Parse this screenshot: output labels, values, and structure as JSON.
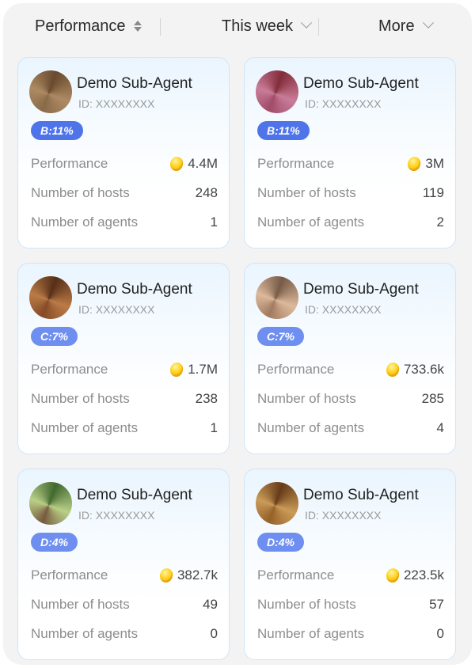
{
  "filters": {
    "performance": "Performance",
    "week": "This week",
    "more": "More"
  },
  "cards": [
    {
      "name": "Demo Sub-Agent",
      "id_label": "ID:",
      "id_value": "XXXXXXXX",
      "badge": "B:11%",
      "performance": "4.4M",
      "hosts": "248",
      "agents": "1",
      "avatar_colors": [
        "#6b4a2a",
        "#b08a5e",
        "#8c6a44"
      ]
    },
    {
      "name": "Demo Sub-Agent",
      "id_label": "ID:",
      "id_value": "XXXXXXXX",
      "badge": "B:11%",
      "performance": "3M",
      "hosts": "119",
      "agents": "2",
      "avatar_colors": [
        "#8a2a3a",
        "#d07a9a",
        "#a84a6a"
      ]
    },
    {
      "name": "Demo Sub-Agent",
      "id_label": "ID:",
      "id_value": "XXXXXXXX",
      "badge": "C:7%",
      "performance": "1.7M",
      "hosts": "238",
      "agents": "1",
      "avatar_colors": [
        "#5a2e14",
        "#c07a40",
        "#8a4a22"
      ]
    },
    {
      "name": "Demo Sub-Agent",
      "id_label": "ID:",
      "id_value": "XXXXXXXX",
      "badge": "C:7%",
      "performance": "733.6k",
      "hosts": "285",
      "agents": "4",
      "avatar_colors": [
        "#7a5a44",
        "#e0b898",
        "#a47a5c"
      ]
    },
    {
      "name": "Demo Sub-Agent",
      "id_label": "ID:",
      "id_value": "XXXXXXXX",
      "badge": "D:4%",
      "performance": "382.7k",
      "hosts": "49",
      "agents": "0",
      "avatar_colors": [
        "#3e6a2a",
        "#b8d080",
        "#7a5a3a"
      ]
    },
    {
      "name": "Demo Sub-Agent",
      "id_label": "ID:",
      "id_value": "XXXXXXXX",
      "badge": "D:4%",
      "performance": "223.5k",
      "hosts": "57",
      "agents": "0",
      "avatar_colors": [
        "#6a3a14",
        "#d09a50",
        "#9a6022"
      ]
    }
  ],
  "labels": {
    "performance": "Performance",
    "hosts": "Number of hosts",
    "agents": "Number of agents"
  },
  "colors": {
    "badge_blue": "#4f74ea",
    "card_border": "#cfe6fa",
    "coin_gold": "#ffd21e"
  }
}
